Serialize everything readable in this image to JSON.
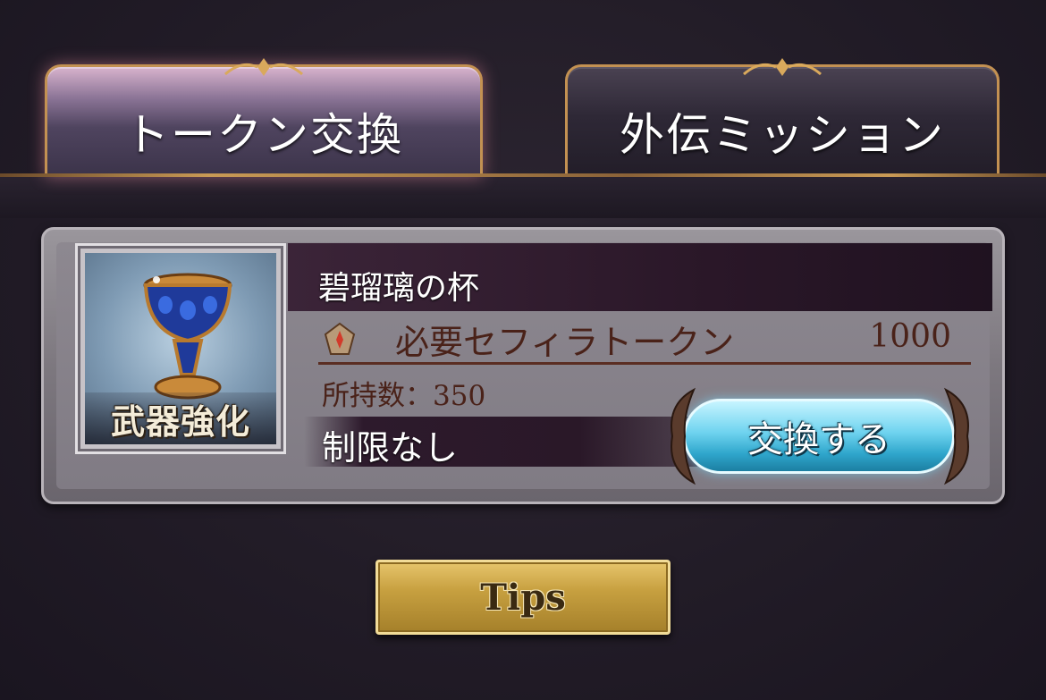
{
  "tabs": {
    "token_exchange": "トークン交換",
    "side_mission": "外伝ミッション"
  },
  "item": {
    "name": "碧瑠璃の杯",
    "category_badge": "武器強化",
    "icon": "chalice-icon",
    "requirement_label": "必要セフィラトークン",
    "requirement_value": "1000",
    "requirement_icon": "sephira-token-icon",
    "owned_label": "所持数：",
    "owned_value": "350",
    "limit_text": "制限なし",
    "exchange_button": "交換する"
  },
  "footer": {
    "tips_button": "Tips"
  },
  "colors": {
    "active_tab_glow": "#ffa0b4",
    "tab_border": "#c39152",
    "name_band": "#2a1728",
    "text_brown": "#4a2219",
    "exchange_button": "#6ed3ef",
    "tips_button": "#c7a040"
  }
}
